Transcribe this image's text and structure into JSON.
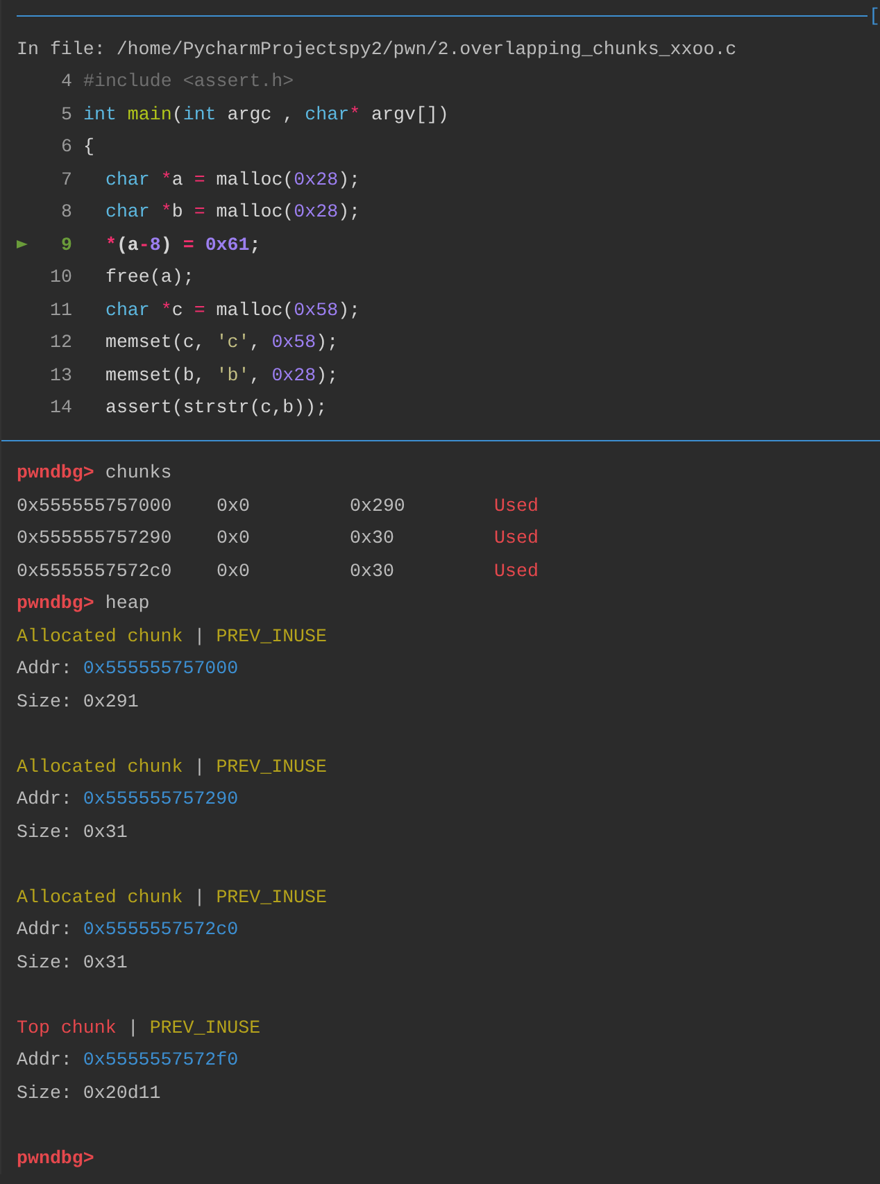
{
  "header": {
    "rule_end": "[",
    "file_label": "In file: /home/PycharmProjectspy2/pwn/2.overlapping_chunks_xxoo.c"
  },
  "code_lines": [
    {
      "number": "4",
      "current": false,
      "tokens": [
        {
          "text": "#include <assert.h>",
          "kind": "comment"
        }
      ]
    },
    {
      "number": "5",
      "current": false,
      "tokens": [
        {
          "text": "int",
          "kind": "keyword"
        },
        {
          "text": " main",
          "kind": "function"
        },
        {
          "text": "(",
          "kind": "plain"
        },
        {
          "text": "int",
          "kind": "keyword"
        },
        {
          "text": " argc , ",
          "kind": "plain"
        },
        {
          "text": "char",
          "kind": "keyword"
        },
        {
          "text": "*",
          "kind": "operator"
        },
        {
          "text": " argv[])",
          "kind": "plain"
        }
      ]
    },
    {
      "number": "6",
      "current": false,
      "tokens": [
        {
          "text": "{",
          "kind": "plain"
        }
      ]
    },
    {
      "number": "7",
      "current": false,
      "tokens": [
        {
          "text": "  char",
          "kind": "keyword"
        },
        {
          "text": " *",
          "kind": "operator"
        },
        {
          "text": "a ",
          "kind": "plain"
        },
        {
          "text": "=",
          "kind": "operator"
        },
        {
          "text": " malloc(",
          "kind": "plain"
        },
        {
          "text": "0x28",
          "kind": "number"
        },
        {
          "text": ");",
          "kind": "plain"
        }
      ]
    },
    {
      "number": "8",
      "current": false,
      "tokens": [
        {
          "text": "  char",
          "kind": "keyword"
        },
        {
          "text": " *",
          "kind": "operator"
        },
        {
          "text": "b ",
          "kind": "plain"
        },
        {
          "text": "=",
          "kind": "operator"
        },
        {
          "text": " malloc(",
          "kind": "plain"
        },
        {
          "text": "0x28",
          "kind": "number"
        },
        {
          "text": ");",
          "kind": "plain"
        }
      ]
    },
    {
      "number": "9",
      "current": true,
      "tokens": [
        {
          "text": "  *",
          "kind": "operator"
        },
        {
          "text": "(a",
          "kind": "plain"
        },
        {
          "text": "-",
          "kind": "operator"
        },
        {
          "text": "8",
          "kind": "number"
        },
        {
          "text": ") ",
          "kind": "plain"
        },
        {
          "text": "=",
          "kind": "operator"
        },
        {
          "text": " 0x61",
          "kind": "number"
        },
        {
          "text": ";",
          "kind": "plain"
        }
      ]
    },
    {
      "number": "10",
      "current": false,
      "tokens": [
        {
          "text": "  free(a);",
          "kind": "plain"
        }
      ]
    },
    {
      "number": "11",
      "current": false,
      "tokens": [
        {
          "text": "  char",
          "kind": "keyword"
        },
        {
          "text": " *",
          "kind": "operator"
        },
        {
          "text": "c ",
          "kind": "plain"
        },
        {
          "text": "=",
          "kind": "operator"
        },
        {
          "text": " malloc(",
          "kind": "plain"
        },
        {
          "text": "0x58",
          "kind": "number"
        },
        {
          "text": ");",
          "kind": "plain"
        }
      ]
    },
    {
      "number": "12",
      "current": false,
      "tokens": [
        {
          "text": "  memset(c, ",
          "kind": "plain"
        },
        {
          "text": "'c'",
          "kind": "string"
        },
        {
          "text": ", ",
          "kind": "plain"
        },
        {
          "text": "0x58",
          "kind": "number"
        },
        {
          "text": ");",
          "kind": "plain"
        }
      ]
    },
    {
      "number": "13",
      "current": false,
      "tokens": [
        {
          "text": "  memset(b, ",
          "kind": "plain"
        },
        {
          "text": "'b'",
          "kind": "string"
        },
        {
          "text": ", ",
          "kind": "plain"
        },
        {
          "text": "0x28",
          "kind": "number"
        },
        {
          "text": ");",
          "kind": "plain"
        }
      ]
    },
    {
      "number": "14",
      "current": false,
      "tokens": [
        {
          "text": "  assert(strstr(c,b));",
          "kind": "plain"
        }
      ]
    }
  ],
  "console": [
    {
      "kind": "prompt",
      "prompt": "pwndbg>",
      "command": "chunks"
    },
    {
      "kind": "chunk_row",
      "cells": [
        "0x555555757000",
        "0x0",
        "0x290"
      ],
      "status": "Used"
    },
    {
      "kind": "chunk_row",
      "cells": [
        "0x555555757290",
        "0x0",
        "0x30"
      ],
      "status": "Used"
    },
    {
      "kind": "chunk_row",
      "cells": [
        "0x5555557572c0",
        "0x0",
        "0x30"
      ],
      "status": "Used"
    },
    {
      "kind": "prompt",
      "prompt": "pwndbg>",
      "command": "heap"
    },
    {
      "kind": "allocated_title",
      "title": "Allocated chunk",
      "separator": "|",
      "flag": "PREV_INUSE"
    },
    {
      "kind": "address_field",
      "label": "Addr:",
      "value": "0x555555757000"
    },
    {
      "kind": "size_field",
      "label": "Size:",
      "value": "0x291"
    },
    {
      "kind": "blank"
    },
    {
      "kind": "allocated_title",
      "title": "Allocated chunk",
      "separator": "|",
      "flag": "PREV_INUSE"
    },
    {
      "kind": "address_field",
      "label": "Addr:",
      "value": "0x555555757290"
    },
    {
      "kind": "size_field",
      "label": "Size:",
      "value": "0x31"
    },
    {
      "kind": "blank"
    },
    {
      "kind": "allocated_title",
      "title": "Allocated chunk",
      "separator": "|",
      "flag": "PREV_INUSE"
    },
    {
      "kind": "address_field",
      "label": "Addr:",
      "value": "0x5555557572c0"
    },
    {
      "kind": "size_field",
      "label": "Size:",
      "value": "0x31"
    },
    {
      "kind": "blank"
    },
    {
      "kind": "top_title",
      "title": "Top chunk",
      "separator": "|",
      "flag": "PREV_INUSE"
    },
    {
      "kind": "address_field",
      "label": "Addr:",
      "value": "0x5555557572f0"
    },
    {
      "kind": "size_field",
      "label": "Size:",
      "value": "0x20d11"
    },
    {
      "kind": "blank"
    },
    {
      "kind": "prompt",
      "prompt": "pwndbg>"
    }
  ]
}
